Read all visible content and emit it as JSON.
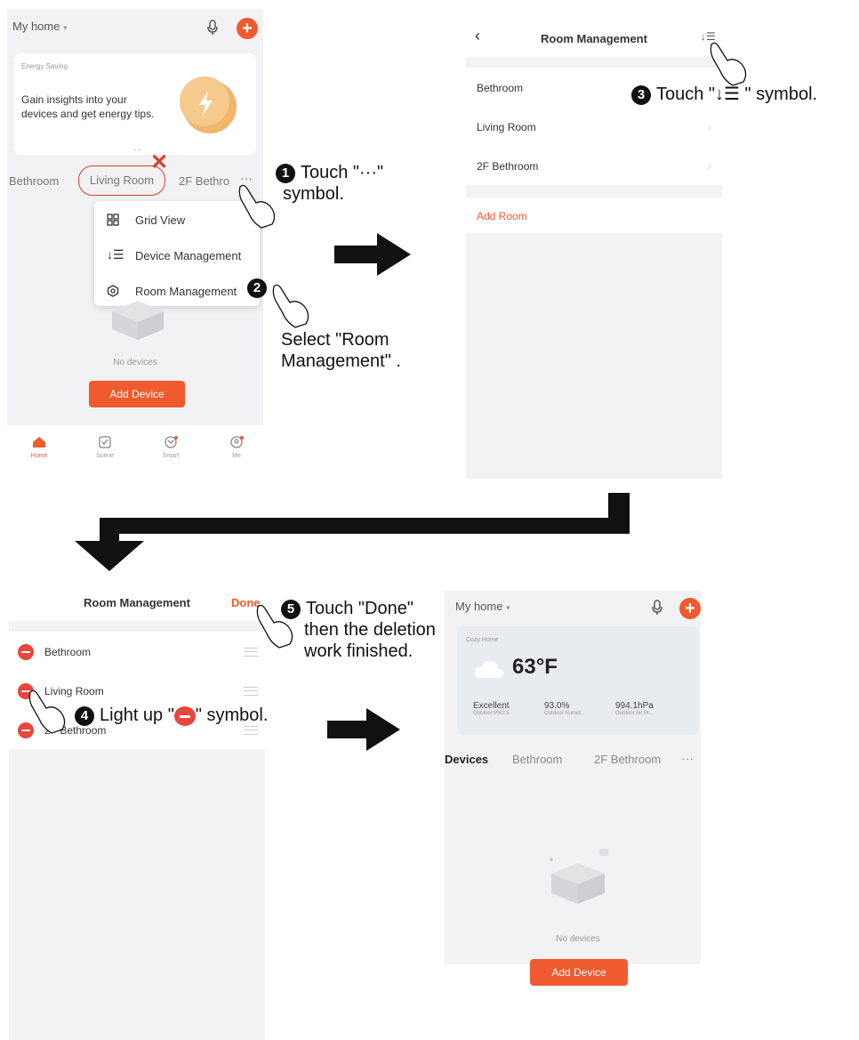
{
  "screen1": {
    "home_title": "My home",
    "banner_tag": "Energy Saving",
    "banner_text": "Gain insights into your devices and get energy tips.",
    "tabs": [
      "Bethroom",
      "Living Room",
      "2F Bethro"
    ],
    "more_symbol": "···",
    "menu": [
      {
        "label": "Grid View",
        "icon": "grid-icon"
      },
      {
        "label": "Device Management",
        "icon": "sort-list-icon"
      },
      {
        "label": "Room Management",
        "icon": "settings-icon"
      }
    ],
    "empty_text": "No devices",
    "add_device": "Add Device",
    "nav": [
      "Home",
      "Scene",
      "Smart",
      "Me"
    ]
  },
  "screen2": {
    "title": "Room Management",
    "rooms": [
      "Bethroom",
      "Living Room",
      "2F Bethroom"
    ],
    "add_room": "Add Room"
  },
  "screen3": {
    "title": "Room Management",
    "done": "Done",
    "rooms": [
      "Bethroom",
      "Living Room",
      "2F Bethroom"
    ]
  },
  "screen4": {
    "home_title": "My home",
    "weather_tag": "Cozy Home",
    "temperature": "63°F",
    "stats": [
      {
        "value": "Excellent",
        "label": "Outdoor PM2.5"
      },
      {
        "value": "93.0%",
        "label": "Outdoor Humid..."
      },
      {
        "value": "994.1hPa",
        "label": "Outdoor Air Pr..."
      }
    ],
    "tabs": [
      "Devices",
      "Bethroom",
      "2F Bethroom"
    ],
    "more_symbol": "···",
    "empty_text": "No devices",
    "add_device": "Add Device"
  },
  "instructions": {
    "step1_a": "Touch \"···\"",
    "step1_b": "symbol.",
    "step2_a": "Select \"Room",
    "step2_b": "Management\" .",
    "step3": "Touch \"↓☰ \" symbol.",
    "step4_a": "Light up \"",
    "step4_b": "\" symbol.",
    "step5_a": "Touch \"Done\"",
    "step5_b": "then the deletion",
    "step5_c": "work finished.",
    "numbers": [
      "1",
      "2",
      "3",
      "4",
      "5"
    ]
  },
  "colors": {
    "accent": "#ef5a2f",
    "minus": "#e8463c",
    "bg": "#f2f2f4"
  }
}
